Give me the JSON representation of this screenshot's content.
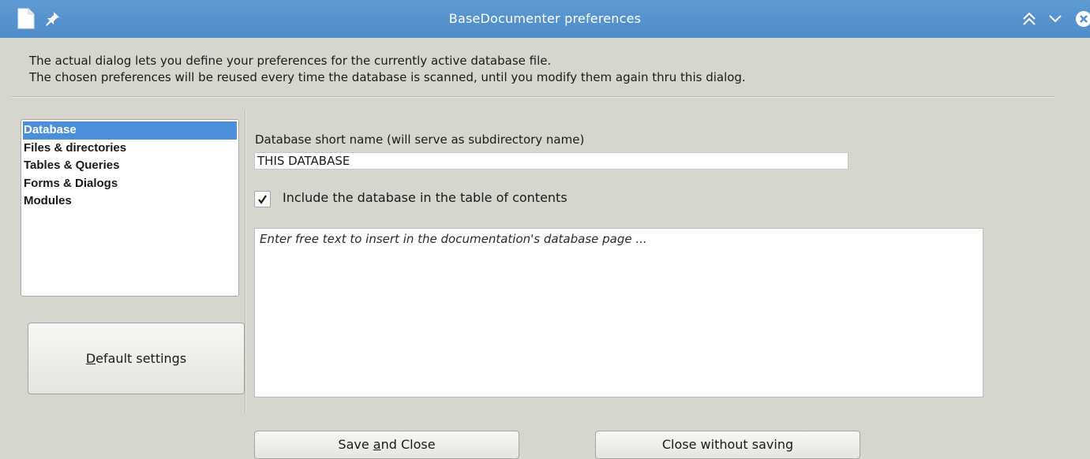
{
  "window": {
    "title": "BaseDocumenter preferences"
  },
  "intro": {
    "line1": "The actual dialog lets you define your preferences for the currently active database file.",
    "line2": "The chosen preferences will be reused every time the database is scanned, until you modify them again thru this dialog."
  },
  "sections": {
    "items": [
      {
        "label": "Database",
        "selected": true
      },
      {
        "label": "Files & directories",
        "selected": false
      },
      {
        "label": "Tables & Queries",
        "selected": false
      },
      {
        "label": "Forms & Dialogs",
        "selected": false
      },
      {
        "label": "Modules",
        "selected": false
      }
    ]
  },
  "default_button": {
    "mnemonic": "D",
    "rest": "efault settings"
  },
  "database": {
    "short_name_label": "Database short name (will serve as subdirectory name)",
    "short_name_value": "THIS DATABASE",
    "include_toc_label": "Include the database in the table of contents",
    "include_toc_checked": true,
    "free_text_placeholder": "Enter free text to insert in the documentation's database page ...",
    "free_text_value": ""
  },
  "footer": {
    "save": {
      "before": "Save ",
      "mnemonic": "a",
      "after": "nd Close"
    },
    "close_label": "Close without saving"
  },
  "colors": {
    "titlebar": "#4f8cc9",
    "selection": "#4a8fd8",
    "dialog_bg": "#d6d6cf"
  },
  "icons": {
    "app": "document-icon",
    "pin": "pin-icon",
    "keep_above": "keep-above-icon",
    "minimize": "minimize-icon",
    "close": "close-icon"
  }
}
